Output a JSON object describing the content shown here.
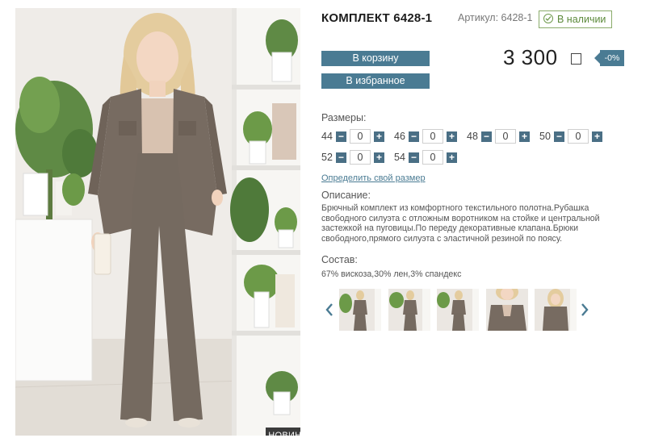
{
  "product": {
    "title": "КОМПЛЕКТ 6428-1",
    "sku": "Артикул: 6428-1",
    "stock": "В наличии",
    "badge": "НОВИНКА",
    "price": "3 300",
    "discount": "-0%"
  },
  "buttons": {
    "cart": "В корзину",
    "favorite": "В избранное"
  },
  "sizes": {
    "label": "Размеры:",
    "items": [
      {
        "size": "44",
        "qty": "0"
      },
      {
        "size": "46",
        "qty": "0"
      },
      {
        "size": "48",
        "qty": "0"
      },
      {
        "size": "50",
        "qty": "0"
      },
      {
        "size": "52",
        "qty": "0"
      },
      {
        "size": "54",
        "qty": "0"
      }
    ],
    "link": "Определить свой размер"
  },
  "description": {
    "label": "Описание:",
    "text": "Брючный комплект из комфортного текстильного полотна.Рубашка свободного силуэта с отложным воротником на стойке и центральной застежкой на пуговицы.По переду декоративные клапана.Брюки свободного,прямого силуэта с эластичной резиной по поясу."
  },
  "composition": {
    "label": "Состав:",
    "text": "67% вискоза,30% лен,3% спандекс"
  },
  "colors": {
    "accent": "#4a7b93",
    "suit": "#75695f",
    "stock_green": "#5c8a3a"
  },
  "icons": {
    "stock": "check-circle-icon",
    "currency": "ruble-icon",
    "prev": "chevron-left-icon",
    "next": "chevron-right-icon",
    "minus": "minus-icon",
    "plus": "plus-icon"
  }
}
